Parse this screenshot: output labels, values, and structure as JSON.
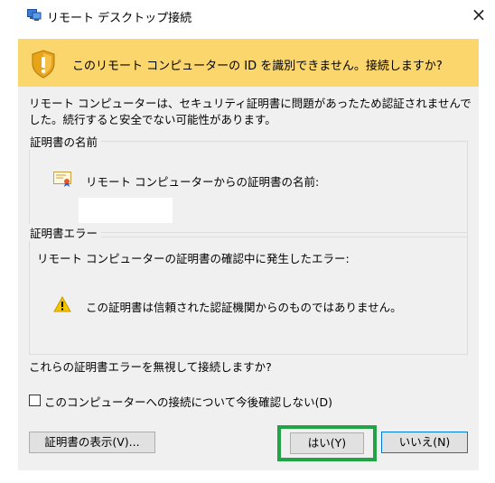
{
  "window": {
    "title": "リモート デスクトップ接続",
    "close_symbol": "×"
  },
  "banner": {
    "message": "このリモート コンピューターの ID を識別できません。接続しますか?",
    "color": "#fbd66d"
  },
  "description": "リモート コンピューターは、セキュリティ証明書に問題があったため認証されませんでした。続行すると安全でない可能性があります。",
  "certificate_name_group": {
    "legend": "証明書の名前",
    "label": "リモート コンピューターからの証明書の名前:",
    "name_value": ""
  },
  "certificate_error_group": {
    "legend": "証明書エラー",
    "label": "リモート コンピューターの証明書の確認中に発生したエラー:",
    "errors": [
      "この証明書は信頼された認証機関からのものではありません。"
    ]
  },
  "question": "これらの証明書エラーを無視して接続しますか?",
  "dont_ask_checkbox": {
    "label": "このコンピューターへの接続について今後確認しない(D)",
    "checked": false
  },
  "buttons": {
    "view_certificate": "証明書の表示(V)...",
    "yes": "はい(Y)",
    "no": "いいえ(N)"
  },
  "highlight_color": "#22a345",
  "icons": [
    "remote-desktop-icon",
    "shield-warning-icon",
    "certificate-icon",
    "warning-icon",
    "close-icon"
  ]
}
